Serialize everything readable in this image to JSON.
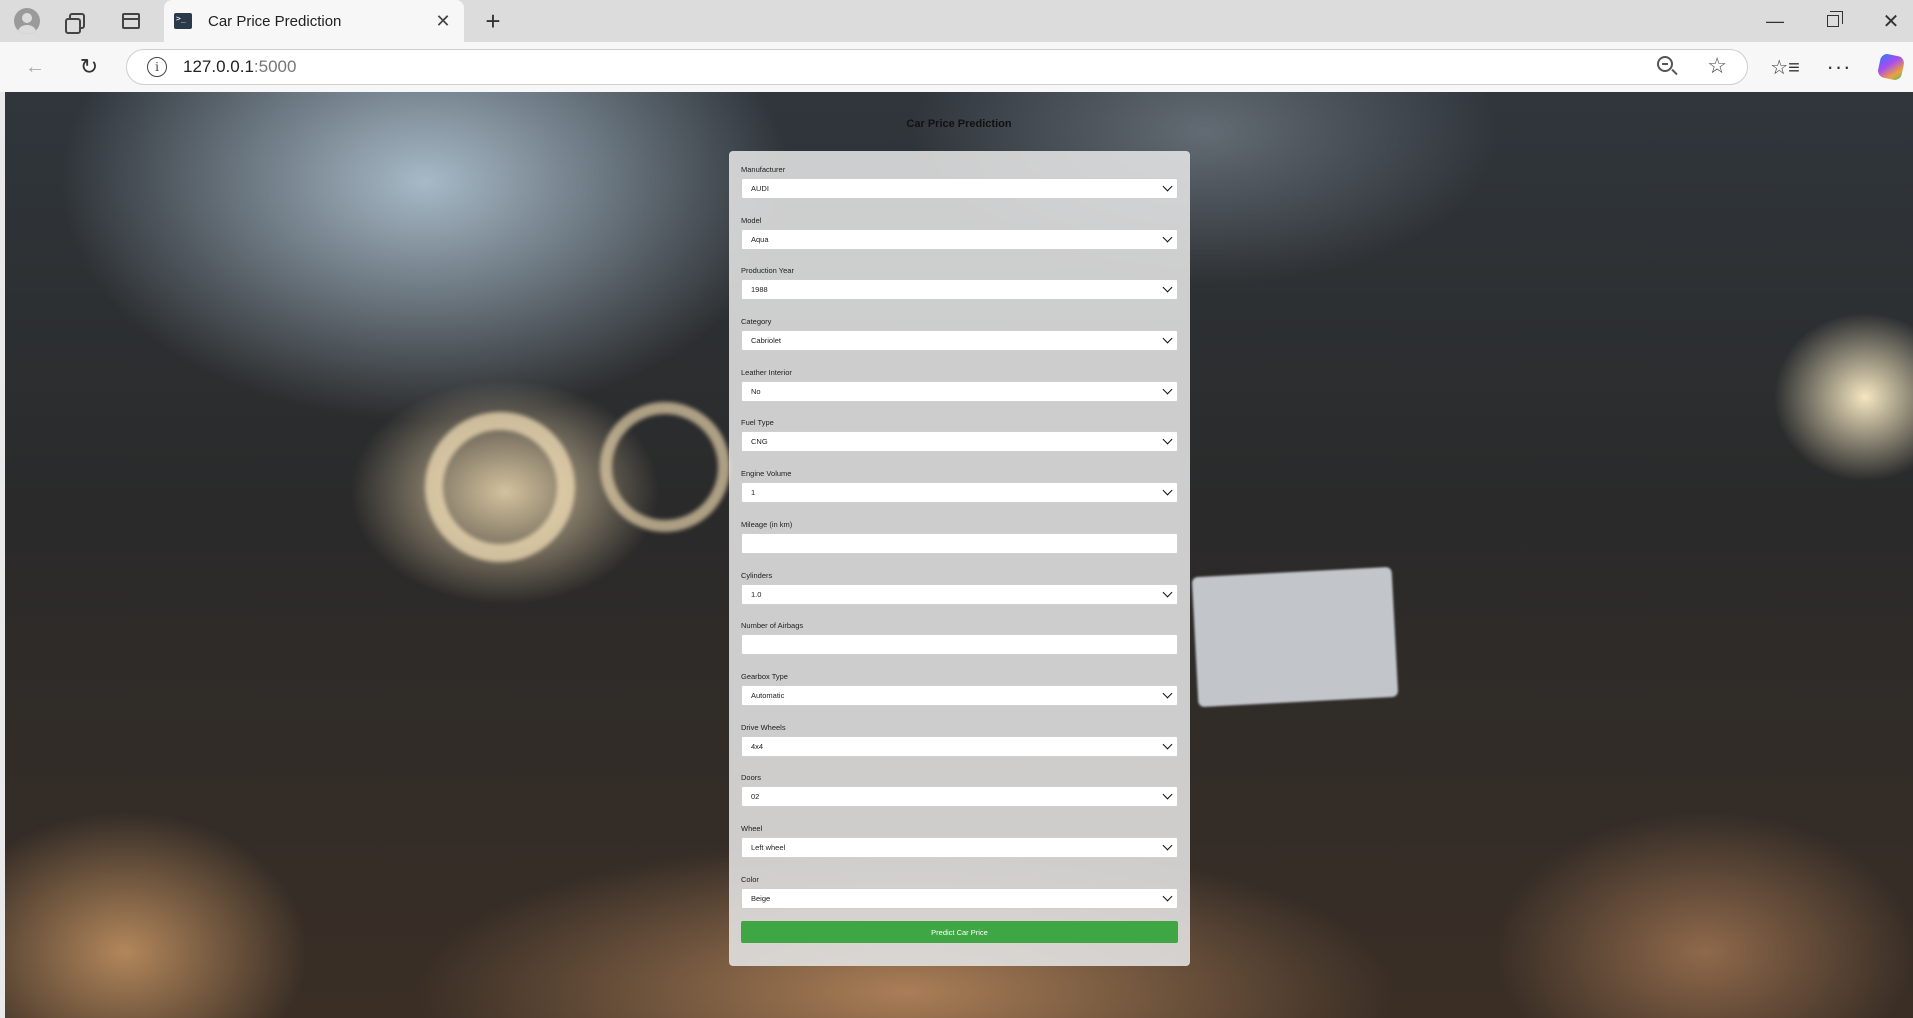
{
  "browser": {
    "tab_title": "Car Price Prediction",
    "url_host": "127.0.0.1",
    "url_port": ":5000"
  },
  "page": {
    "title": "Car Price Prediction"
  },
  "form": {
    "fields": [
      {
        "label": "Manufacturer",
        "type": "select",
        "value": "AUDI"
      },
      {
        "label": "Model",
        "type": "select",
        "value": "Aqua"
      },
      {
        "label": "Production Year",
        "type": "select",
        "value": "1988"
      },
      {
        "label": "Category",
        "type": "select",
        "value": "Cabriolet"
      },
      {
        "label": "Leather Interior",
        "type": "select",
        "value": "No"
      },
      {
        "label": "Fuel Type",
        "type": "select",
        "value": "CNG"
      },
      {
        "label": "Engine Volume",
        "type": "select",
        "value": "1"
      },
      {
        "label": "Mileage (in km)",
        "type": "input",
        "value": ""
      },
      {
        "label": "Cylinders",
        "type": "select",
        "value": "1.0"
      },
      {
        "label": "Number of Airbags",
        "type": "input",
        "value": ""
      },
      {
        "label": "Gearbox Type",
        "type": "select",
        "value": "Automatic"
      },
      {
        "label": "Drive Wheels",
        "type": "select",
        "value": "4x4"
      },
      {
        "label": "Doors",
        "type": "select",
        "value": "02"
      },
      {
        "label": "Wheel",
        "type": "select",
        "value": "Left wheel"
      },
      {
        "label": "Color",
        "type": "select",
        "value": "Beige"
      }
    ],
    "submit_label": "Predict Car Price",
    "submit_color": "#3fa644"
  }
}
